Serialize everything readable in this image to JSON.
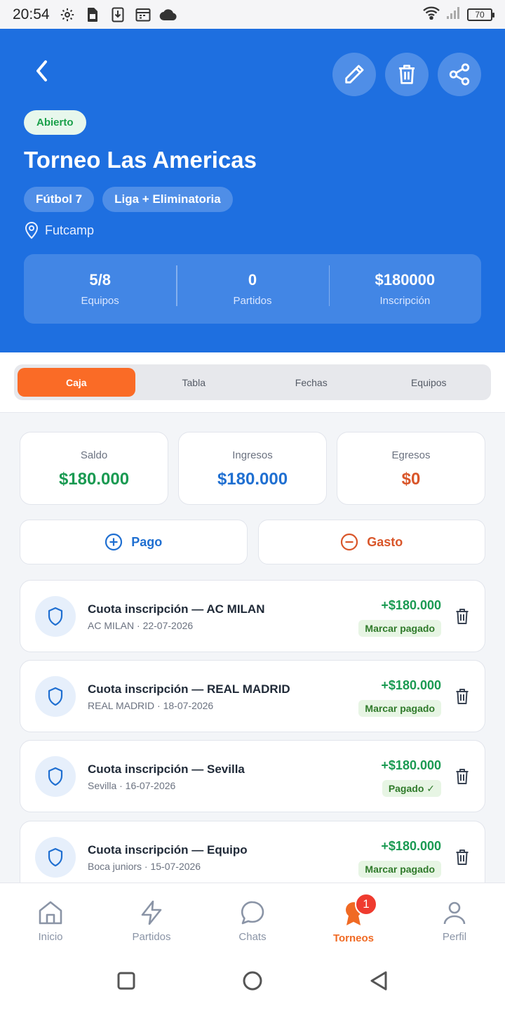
{
  "status_bar": {
    "time": "20:54",
    "battery": "70"
  },
  "header": {
    "status_badge": "Abierto",
    "title": "Torneo Las Americas",
    "chips": [
      "Fútbol 7",
      "Liga + Eliminatoria"
    ],
    "location": "Futcamp",
    "stats": [
      {
        "value": "5/8",
        "label": "Equipos"
      },
      {
        "value": "0",
        "label": "Partidos"
      },
      {
        "value": "$180000",
        "label": "Inscripción"
      }
    ]
  },
  "tabs": [
    "Caja",
    "Tabla",
    "Fechas",
    "Equipos"
  ],
  "summary": {
    "saldo": {
      "label": "Saldo",
      "value": "$180.000"
    },
    "ingresos": {
      "label": "Ingresos",
      "value": "$180.000"
    },
    "egresos": {
      "label": "Egresos",
      "value": "$0"
    }
  },
  "actions": {
    "pago": "Pago",
    "gasto": "Gasto"
  },
  "transactions": [
    {
      "title": "Cuota inscripción — AC MILAN",
      "subtitle": "AC MILAN · 22-07-2026",
      "amount": "+$180.000",
      "status": "Marcar pagado"
    },
    {
      "title": "Cuota inscripción — REAL MADRID",
      "subtitle": "REAL MADRID · 18-07-2026",
      "amount": "+$180.000",
      "status": "Marcar pagado"
    },
    {
      "title": "Cuota inscripción — Sevilla",
      "subtitle": "Sevilla · 16-07-2026",
      "amount": "+$180.000",
      "status": "Pagado ✓"
    },
    {
      "title": "Cuota inscripción — Equipo",
      "subtitle": "Boca juniors · 15-07-2026",
      "amount": "+$180.000",
      "status": "Marcar pagado"
    }
  ],
  "bottom_nav": {
    "items": [
      "Inicio",
      "Partidos",
      "Chats",
      "Torneos",
      "Perfil"
    ],
    "torneos_badge": "1"
  },
  "colors": {
    "header_blue": "#1e6fe0",
    "accent_orange": "#fa6b26",
    "positive_green": "#1a9a52",
    "income_blue": "#1f6fd1",
    "expense_orange": "#d9562a"
  }
}
